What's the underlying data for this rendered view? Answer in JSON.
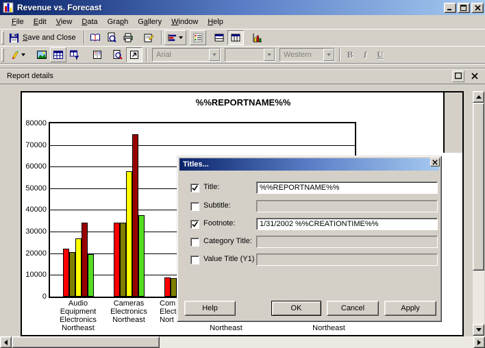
{
  "window": {
    "title": "Revenue vs. Forecast"
  },
  "menu": {
    "items": [
      {
        "label": "File",
        "underline_index": 0
      },
      {
        "label": "Edit",
        "underline_index": 0
      },
      {
        "label": "View",
        "underline_index": 0
      },
      {
        "label": "Data",
        "underline_index": 0
      },
      {
        "label": "Graph",
        "underline_index": 3
      },
      {
        "label": "Gallery",
        "underline_index": 1
      },
      {
        "label": "Window",
        "underline_index": 0
      },
      {
        "label": "Help",
        "underline_index": 0
      }
    ]
  },
  "toolbar_main": {
    "save_and_close": {
      "label": "Save and Close",
      "underline_index": 0
    },
    "icons": [
      "save-icon",
      "open-book-icon",
      "print-preview-icon",
      "print-icon",
      "report-properties-icon",
      "chart-type-icon",
      "field-chooser-icon",
      "layout-rows-icon",
      "layout-columns-icon",
      "insert-graph-icon"
    ]
  },
  "toolbar_format": {
    "icons": [
      "format-pen-icon",
      "insert-picture-icon",
      "data-grid-icon",
      "filter-grid-icon",
      "record-book-icon",
      "zoom-page-icon",
      "open-window-icon"
    ],
    "font_family": {
      "value": "Arial",
      "disabled": true
    },
    "font_size": {
      "value": "",
      "disabled": true
    },
    "script": {
      "value": "Western",
      "disabled": true
    },
    "bold_label": "B",
    "italic_label": "I",
    "underline_label": "U"
  },
  "panel": {
    "title": "Report details"
  },
  "chart_data": {
    "type": "bar",
    "title": "%%REPORTNAME%%",
    "xlabel": "",
    "ylabel": "",
    "ylim": [
      0,
      80000
    ],
    "yticks": [
      0,
      10000,
      20000,
      30000,
      40000,
      50000,
      60000,
      70000,
      80000
    ],
    "grid": true,
    "categories": [
      {
        "label_lines": [
          "Audio",
          "Equipment",
          "Electronics",
          "Northeast"
        ]
      },
      {
        "label_lines": [
          "Cameras",
          "Electronics",
          "Northeast"
        ]
      },
      {
        "label_lines": [
          "Com",
          "Elect",
          "Nort"
        ],
        "clipped_by_dialog": true
      }
    ],
    "extra_category_labels_below_dialog": [
      "Northeast",
      "Northeast"
    ],
    "series": [
      {
        "name": "red",
        "color": "#FF0000",
        "values": [
          22000,
          34000,
          9000
        ]
      },
      {
        "name": "olive",
        "color": "#808000",
        "values": [
          20500,
          34000,
          8500
        ]
      },
      {
        "name": "yellow",
        "color": "#FFFF00",
        "values": [
          27000,
          58000,
          null
        ]
      },
      {
        "name": "maroon",
        "color": "#990000",
        "values": [
          34000,
          75000,
          null
        ]
      },
      {
        "name": "green",
        "color": "#55DD22",
        "values": [
          19500,
          37500,
          null
        ]
      }
    ]
  },
  "dialog": {
    "title": "Titles...",
    "fields": [
      {
        "id": "title",
        "label": "Title:",
        "checked": true,
        "enabled": true,
        "value": "%%REPORTNAME%%"
      },
      {
        "id": "subtitle",
        "label": "Subtitle:",
        "checked": false,
        "enabled": false,
        "value": ""
      },
      {
        "id": "footnote",
        "label": "Footnote:",
        "checked": true,
        "enabled": true,
        "value": "1/31/2002 %%CREATIONTIME%%"
      },
      {
        "id": "category-title",
        "label": "Category Title:",
        "checked": false,
        "enabled": false,
        "value": ""
      },
      {
        "id": "value-title-y1",
        "label": "Value Title (Y1)",
        "checked": false,
        "enabled": false,
        "value": ""
      }
    ],
    "buttons": [
      {
        "id": "help",
        "label": "Help"
      },
      {
        "id": "ok",
        "label": "OK",
        "default": true
      },
      {
        "id": "cancel",
        "label": "Cancel"
      },
      {
        "id": "apply",
        "label": "Apply"
      }
    ]
  }
}
